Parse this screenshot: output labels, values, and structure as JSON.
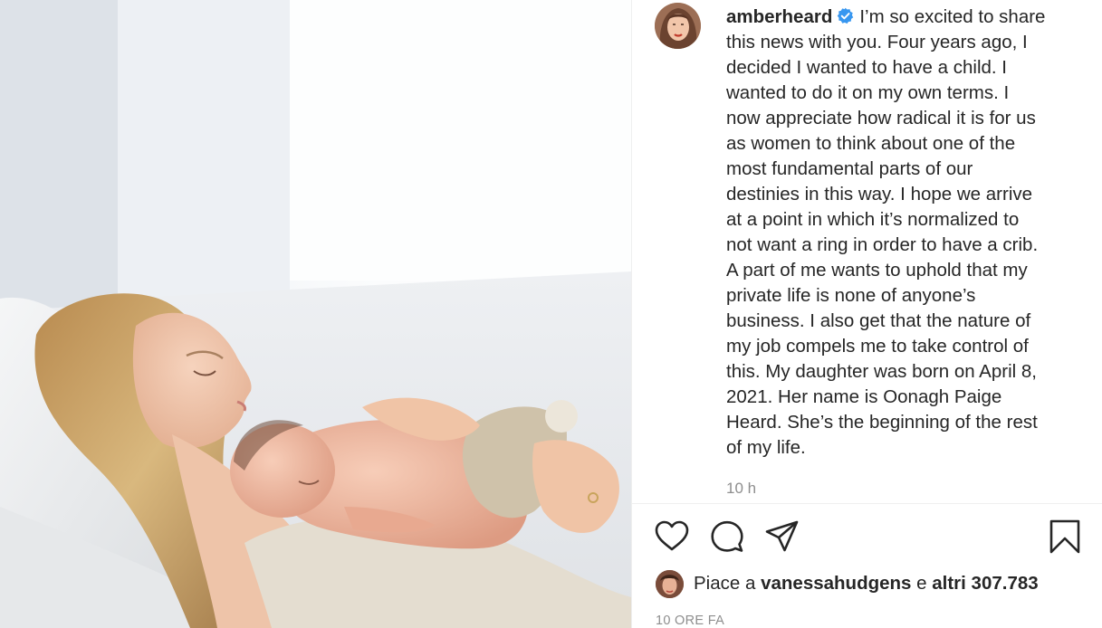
{
  "post": {
    "username": "amberheard",
    "caption_lines": [
      "I’m so excited to share",
      "this news with you. Four years ago, I",
      "decided I wanted to have a child. I",
      "wanted to do it on my own terms. I",
      "now appreciate how radical it is for us",
      "as women to think about one of the",
      "most fundamental parts of our",
      "destinies in this way. I hope we arrive",
      "at a point in which it’s normalized to",
      "not want a ring in order to have a crib.",
      "A part of me wants to uphold that my",
      "private life is none of anyone’s",
      "business. I also get that the nature of",
      "my job compels me to take control of",
      "this. My daughter was born on April 8,",
      "2021. Her name is Oonagh Paige",
      "Heard. She’s the beginning of the rest",
      "of my life."
    ],
    "caption_time": "10 h",
    "verified": true
  },
  "likes": {
    "prefix": "Piace a",
    "liker": "vanessahudgens",
    "connector": "e",
    "others": "altri 307.783"
  },
  "footer": {
    "date": "10 ORE FA"
  },
  "icons": {
    "like": "heart-icon",
    "comment": "comment-icon",
    "share": "share-icon",
    "save": "bookmark-icon",
    "verified": "verified-badge-icon"
  },
  "colors": {
    "verified_blue": "#3897f0",
    "text": "#262626",
    "muted": "#8e8e8e"
  }
}
